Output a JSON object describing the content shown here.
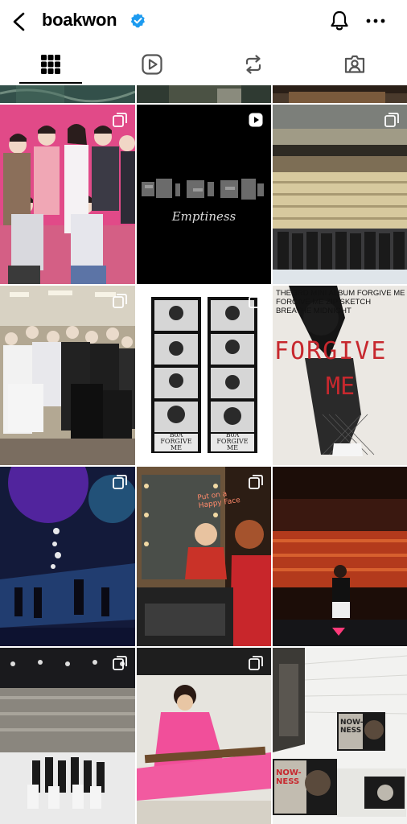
{
  "header": {
    "username": "boakwon",
    "icons": {
      "back": "chevron-left-icon",
      "verified": "verified-badge-icon",
      "notifications": "bell-icon",
      "more": "more-options-icon"
    },
    "colors": {
      "verified": "#1d9bf0",
      "text": "#000000"
    }
  },
  "tabs": [
    {
      "name": "posts-grid",
      "icon": "grid-icon",
      "active": true
    },
    {
      "name": "reels",
      "icon": "reels-icon",
      "active": false
    },
    {
      "name": "reposts",
      "icon": "repost-icon",
      "active": false
    },
    {
      "name": "tagged",
      "icon": "tagged-user-icon",
      "active": false
    }
  ],
  "posts": {
    "emptiness_title": "Emptiness",
    "forgive_me_small": "BoA FORGIVE ME",
    "boa_label_1": "BoA",
    "forgive_label_1": "FORGIVE",
    "me_label_1": "ME",
    "boa_label_2": "BoA",
    "forgive_label_2": "FORGIVE",
    "me_label_2": "ME",
    "poster_headline": "FORGIVE",
    "poster_me": "ME",
    "poster_text_lines": [
      "THE 3RD MINI ALBUM FORGIVE ME",
      "FORGIVE ME  ZIP  SKETCH",
      "BREATHE  MIDNIGHT"
    ],
    "nowness_1": "NOW-NESS",
    "nowness_2": "NOW-NESS",
    "put_on_text": "Put on a Happy Face",
    "badge_types": {
      "carousel": "carousel-icon",
      "reel": "reel-play-icon"
    }
  }
}
